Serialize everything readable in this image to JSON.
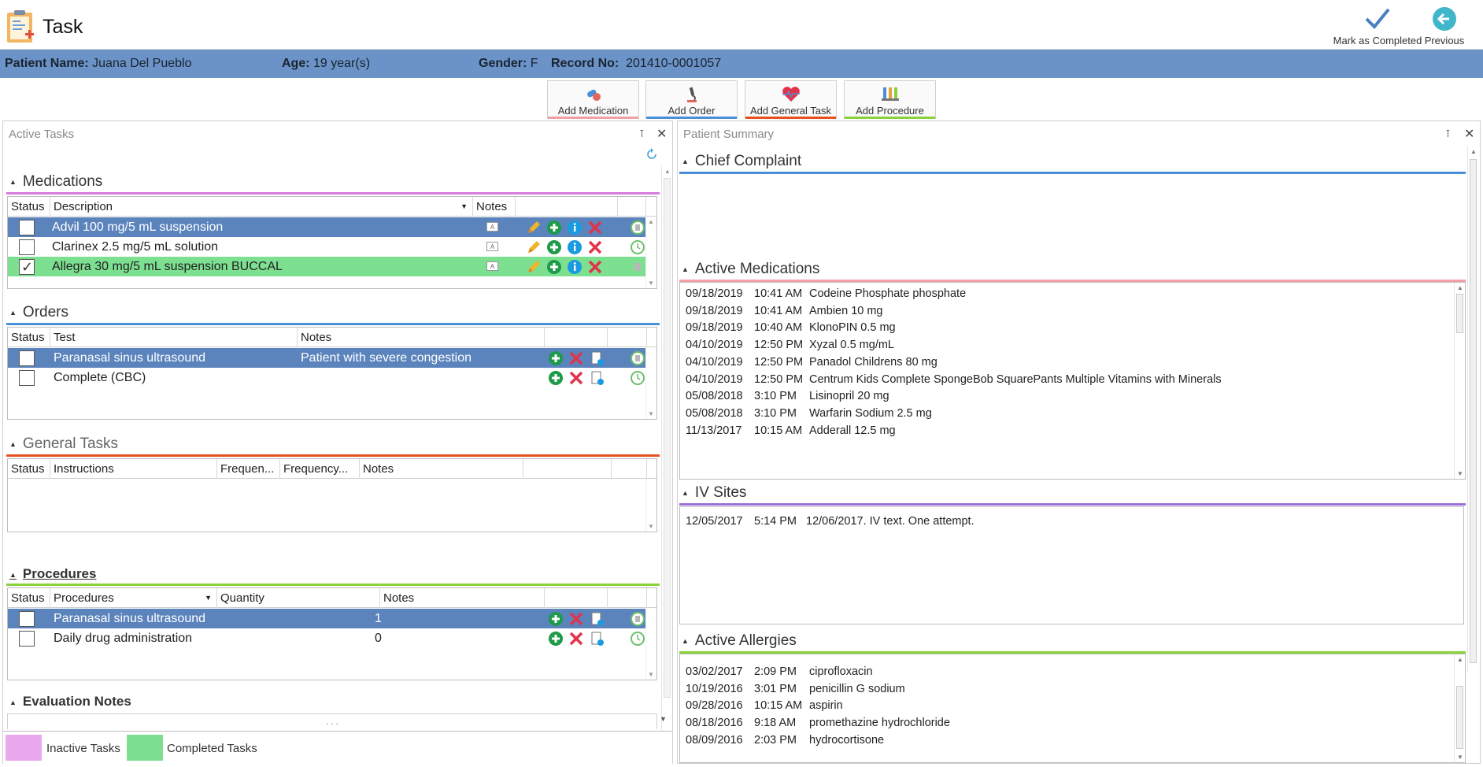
{
  "app": {
    "title": "Task",
    "mark_completed": "Mark as Completed",
    "previous": "Previous"
  },
  "patient": {
    "name_label": "Patient Name:",
    "name": "Juana Del Pueblo",
    "age_label": "Age:",
    "age": "19 year(s)",
    "gender_label": "Gender:",
    "gender": "F",
    "record_label": "Record No:",
    "record": "201410-0001057"
  },
  "add_buttons": [
    {
      "label": "Add Medication",
      "color": "#f2a0a6"
    },
    {
      "label": "Add Order",
      "color": "#4a90d9"
    },
    {
      "label": "Add General Task",
      "color": "#e8501e"
    },
    {
      "label": "Add Procedure",
      "color": "#8ad23a"
    }
  ],
  "active_tasks": {
    "title": "Active Tasks",
    "medications": {
      "title": "Medications",
      "color": "#d77be0",
      "columns": [
        "Status",
        "Description",
        "Notes"
      ],
      "rows": [
        {
          "description": "Advil 100 mg/5 mL suspension",
          "checked": false,
          "state": "selected"
        },
        {
          "description": "Clarinex 2.5 mg/5 mL solution",
          "checked": false,
          "state": "normal"
        },
        {
          "description": "Allegra 30 mg/5 mL suspension BUCCAL",
          "checked": true,
          "state": "completed"
        }
      ]
    },
    "orders": {
      "title": "Orders",
      "color": "#4a90d9",
      "columns": [
        "Status",
        "Test",
        "Notes"
      ],
      "rows": [
        {
          "test": "Paranasal sinus ultrasound",
          "notes": "Patient with severe congestion",
          "state": "selected"
        },
        {
          "test": "Complete (CBC)",
          "notes": "",
          "state": "normal"
        }
      ]
    },
    "general_tasks": {
      "title": "General Tasks",
      "color": "#e8501e",
      "columns": [
        "Status",
        "Instructions",
        "Frequen...",
        "Frequency...",
        "Notes"
      ]
    },
    "procedures": {
      "title": "Procedures",
      "color": "#8ad23a",
      "columns": [
        "Status",
        "Procedures",
        "Quantity",
        "Notes"
      ],
      "rows": [
        {
          "procedure": "Paranasal sinus ultrasound",
          "quantity": "1",
          "state": "selected"
        },
        {
          "procedure": "Daily drug administration",
          "quantity": "0",
          "state": "normal"
        }
      ]
    },
    "evaluation_notes": {
      "title": "Evaluation Notes",
      "ellipsis": ". . ."
    },
    "legend": [
      {
        "label": "Inactive Tasks",
        "color": "#eaa8ee"
      },
      {
        "label": "Completed Tasks",
        "color": "#7ddf90"
      }
    ]
  },
  "patient_summary": {
    "title": "Patient Summary",
    "chief_complaint": {
      "title": "Chief Complaint",
      "color": "#4a90d9"
    },
    "active_medications": {
      "title": "Active Medications",
      "color": "#f2a0a6",
      "rows": [
        {
          "date": "09/18/2019",
          "time": "10:41 AM",
          "name": "Codeine Phosphate phosphate"
        },
        {
          "date": "09/18/2019",
          "time": "10:41 AM",
          "name": "Ambien 10 mg"
        },
        {
          "date": "09/18/2019",
          "time": "10:40 AM",
          "name": "KlonoPIN 0.5 mg"
        },
        {
          "date": "04/10/2019",
          "time": "12:50 PM",
          "name": "Xyzal 0.5 mg/mL"
        },
        {
          "date": "04/10/2019",
          "time": "12:50 PM",
          "name": "Panadol Childrens 80 mg"
        },
        {
          "date": "04/10/2019",
          "time": "12:50 PM",
          "name": "Centrum Kids Complete SpongeBob SquarePants Multiple Vitamins with Minerals"
        },
        {
          "date": "05/08/2018",
          "time": "3:10 PM",
          "name": "Lisinopril 20 mg"
        },
        {
          "date": "05/08/2018",
          "time": "3:10 PM",
          "name": "Warfarin Sodium 2.5 mg"
        },
        {
          "date": "11/13/2017",
          "time": "10:15 AM",
          "name": "Adderall 12.5 mg"
        }
      ]
    },
    "iv_sites": {
      "title": "IV Sites",
      "color": "#9b6fd8",
      "rows": [
        {
          "date": "12/05/2017",
          "time": "5:14 PM",
          "note": "12/06/2017. IV text.  One attempt."
        }
      ]
    },
    "active_allergies": {
      "title": "Active Allergies",
      "color": "#8ad23a",
      "rows": [
        {
          "date": "03/02/2017",
          "time": "2:09 PM",
          "name": "ciprofloxacin"
        },
        {
          "date": "10/19/2016",
          "time": "3:01 PM",
          "name": "penicillin G sodium"
        },
        {
          "date": "09/28/2016",
          "time": "10:15 AM",
          "name": "aspirin"
        },
        {
          "date": "08/18/2016",
          "time": "9:18 AM",
          "name": "promethazine hydrochloride"
        },
        {
          "date": "08/09/2016",
          "time": "2:03 PM",
          "name": "hydrocortisone"
        }
      ]
    }
  }
}
